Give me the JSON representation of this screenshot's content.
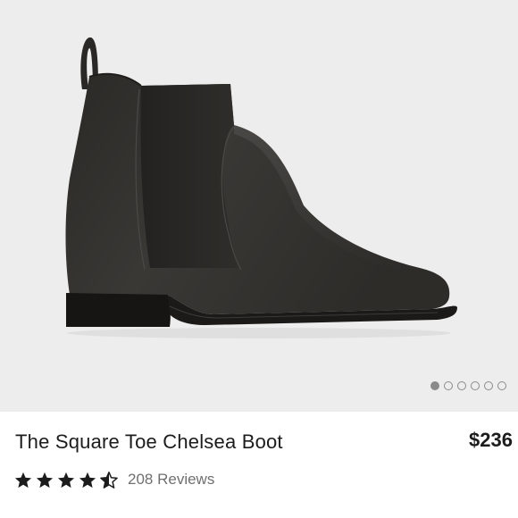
{
  "product": {
    "title": "The Square Toe Chelsea Boot",
    "price": "$236",
    "rating": 4.5,
    "rating_max": 5,
    "reviews_label": "208 Reviews",
    "image_icon": "chelsea-boot-image"
  },
  "gallery": {
    "page_count": 6,
    "active_index": 0
  },
  "colors": {
    "background": "#ededed",
    "text": "#1c1c1c",
    "muted": "#6f6f6f",
    "star": "#1c1c1c",
    "indicator": "#8a8a8a"
  }
}
